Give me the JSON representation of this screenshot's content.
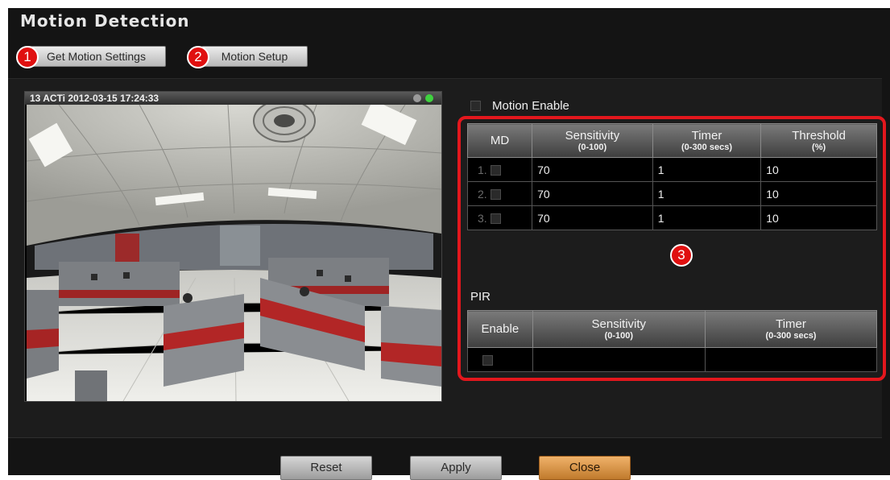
{
  "header": {
    "title": "Motion Detection"
  },
  "toolbar": {
    "get_settings_label": "Get Motion Settings",
    "setup_label": "Motion Setup"
  },
  "badges": [
    "1",
    "2",
    "3"
  ],
  "camera": {
    "overlay_text": "13 ACTi  2012-03-15 17:24:33",
    "indicator_colors": [
      "#9a9a9a",
      "#3fd23f"
    ]
  },
  "motion": {
    "enable_label": "Motion Enable",
    "columns": [
      {
        "title": "MD",
        "sub": ""
      },
      {
        "title": "Sensitivity",
        "sub": "(0-100)"
      },
      {
        "title": "Timer",
        "sub": "(0-300 secs)"
      },
      {
        "title": "Threshold",
        "sub": "(%)"
      }
    ],
    "rows": [
      {
        "index": "1.",
        "sensitivity": "70",
        "timer": "1",
        "threshold": "10"
      },
      {
        "index": "2.",
        "sensitivity": "70",
        "timer": "1",
        "threshold": "10"
      },
      {
        "index": "3.",
        "sensitivity": "70",
        "timer": "1",
        "threshold": "10"
      }
    ]
  },
  "pir": {
    "label": "PIR",
    "columns": [
      {
        "title": "Enable",
        "sub": ""
      },
      {
        "title": "Sensitivity",
        "sub": "(0-100)"
      },
      {
        "title": "Timer",
        "sub": "(0-300 secs)"
      }
    ]
  },
  "footer": {
    "reset_label": "Reset",
    "apply_label": "Apply",
    "close_label": "Close"
  },
  "colors": {
    "highlight_border": "#e3171d",
    "close_button": "#d08a3c"
  }
}
